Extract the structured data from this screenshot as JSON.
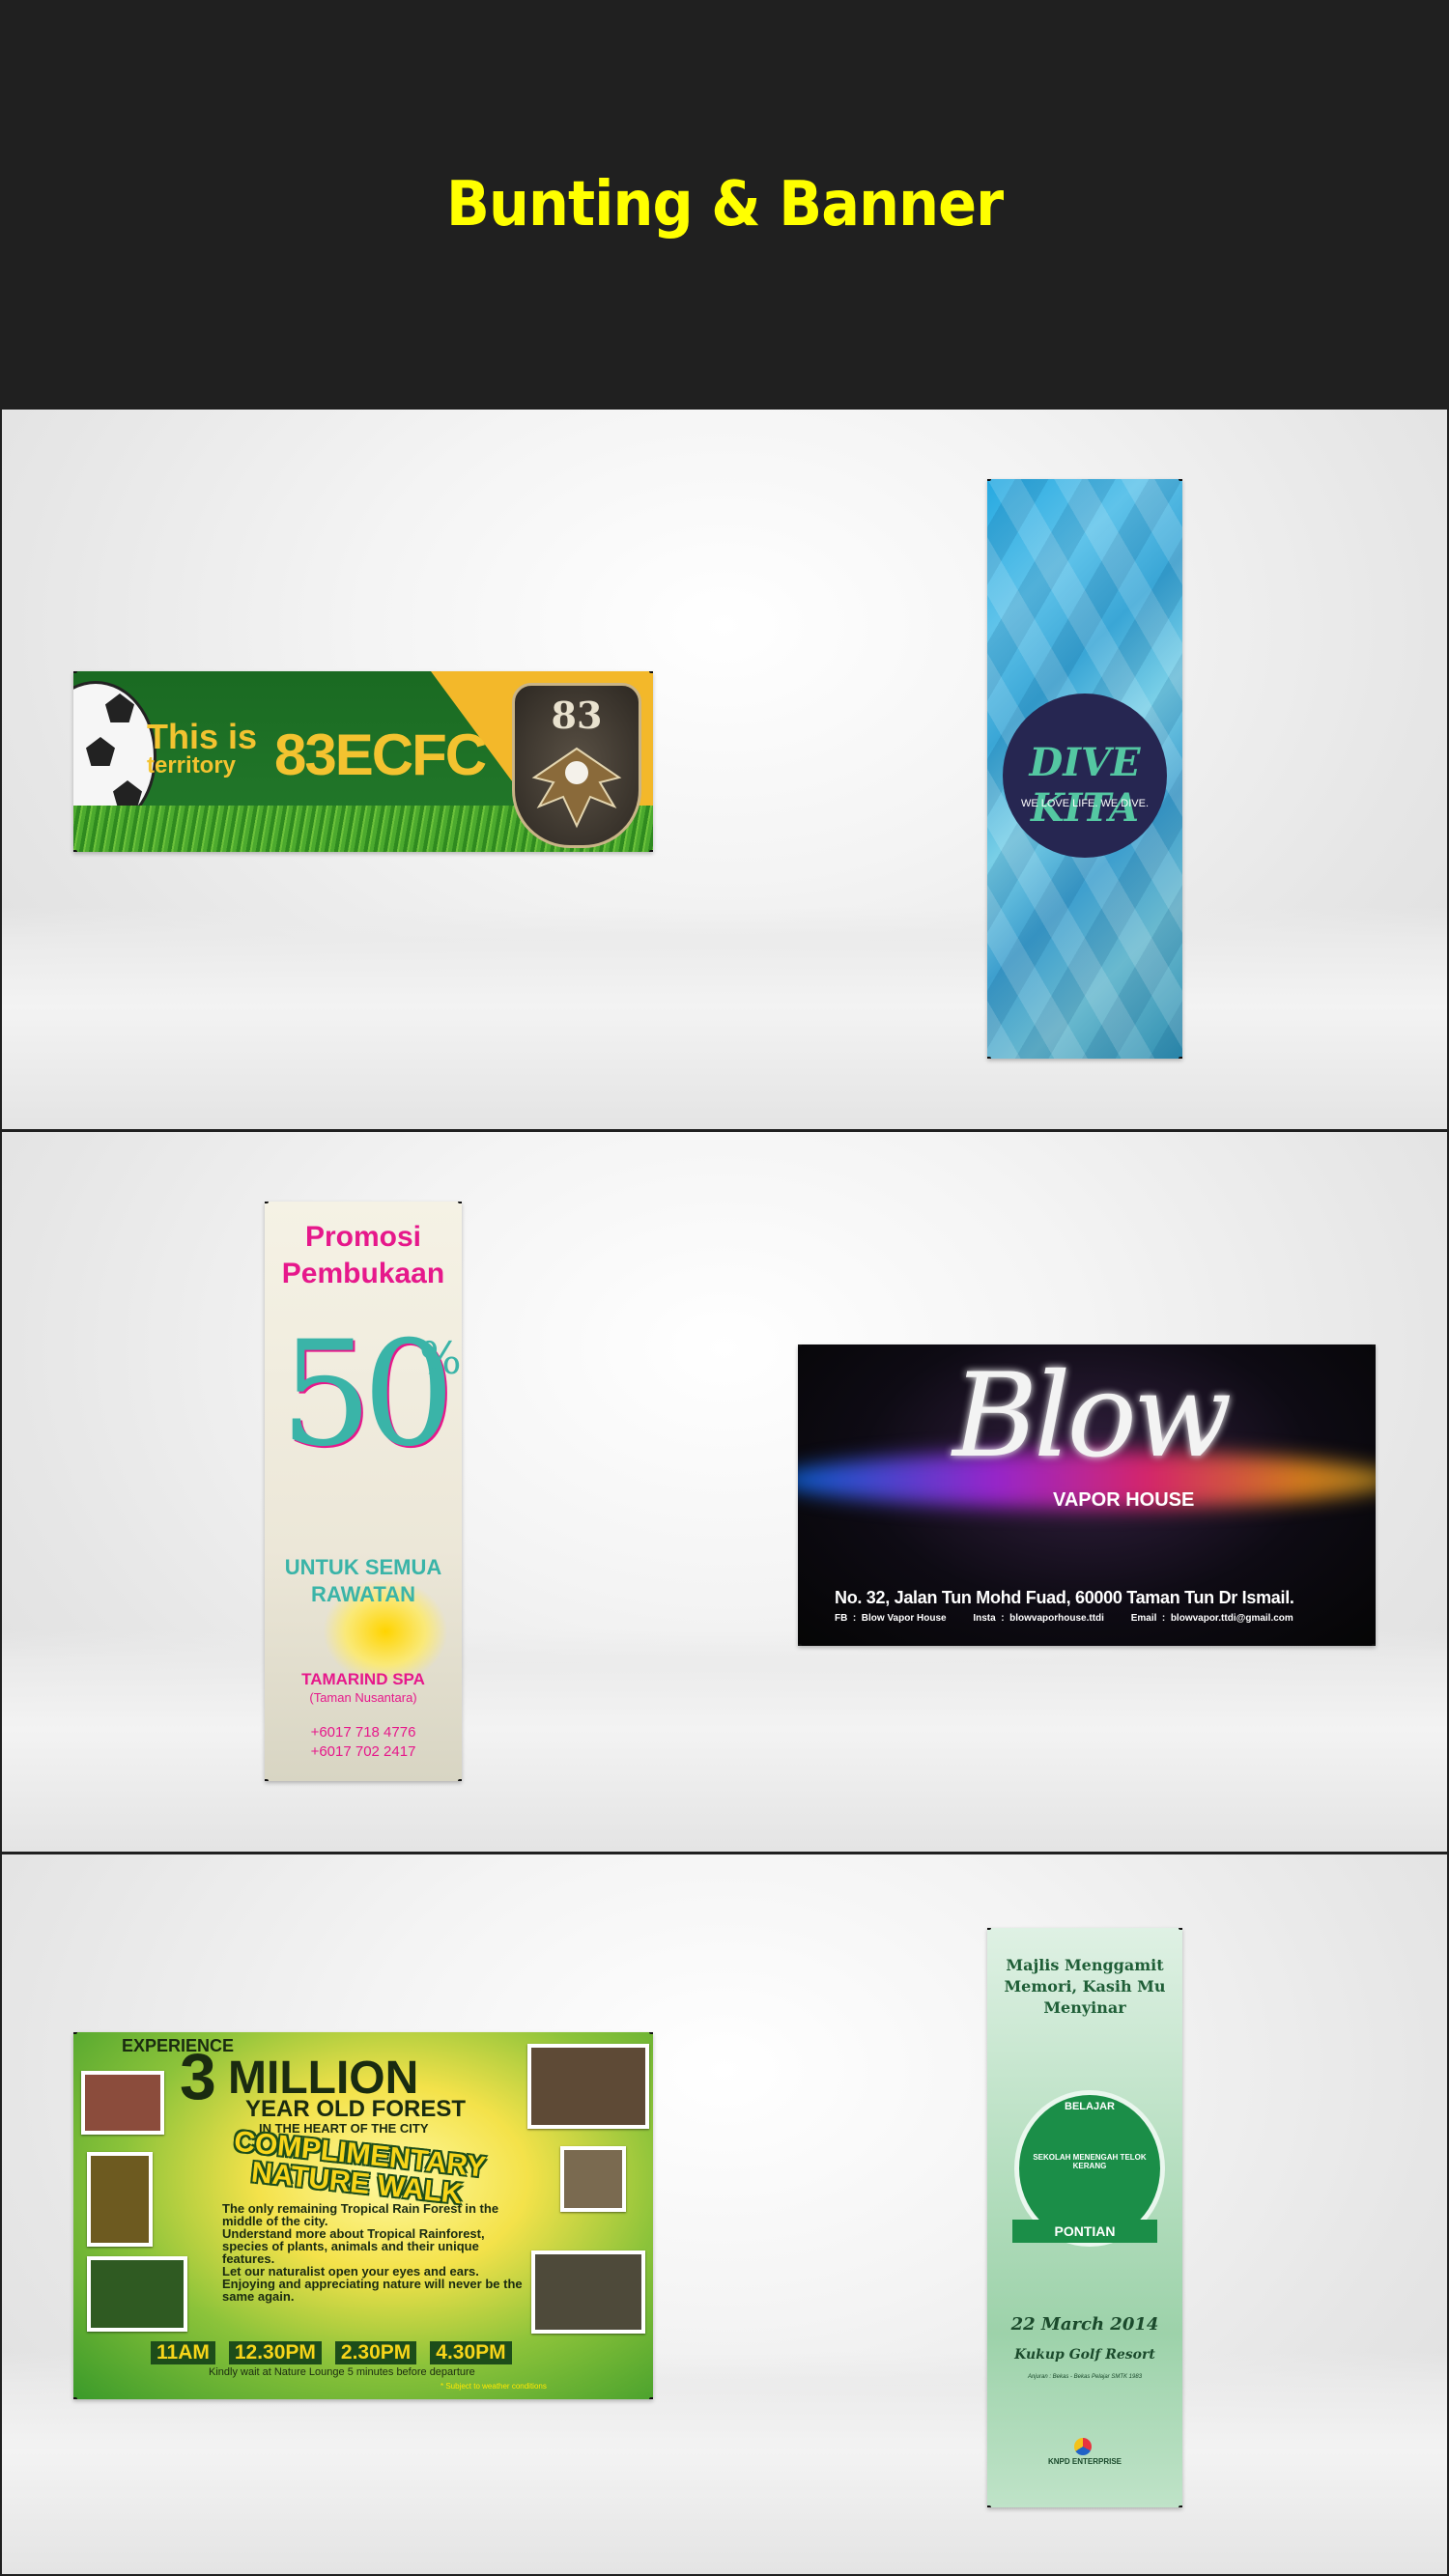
{
  "header": {
    "title": "Bunting & Banner"
  },
  "banners": {
    "fc": {
      "line1": "This is",
      "line2": "territory",
      "club": "83ECFC",
      "crest_text": "83"
    },
    "dive": {
      "logo": "DIVE KITA",
      "tagline": "WE LOVE LIFE. WE DIVE."
    },
    "spa": {
      "promo": "Promosi Pembukaan",
      "discount": "50",
      "percent": "%",
      "untuk": "UNTUK SEMUA RAWATAN",
      "name": "TAMARIND SPA",
      "location": "(Taman Nusantara)",
      "phones": "+6017 718 4776\n+6017 702 2417"
    },
    "vapor": {
      "logo": "Blow",
      "sub": "VAPOR HOUSE",
      "address": "No. 32, Jalan Tun Mohd Fuad, 60000 Taman Tun Dr Ismail.",
      "contacts": "FB  :  Blow Vapor House          Insta  :  blowvaporhouse.ttdi          Email  :  blowvapor.ttdi@gmail.com"
    },
    "forest": {
      "experience": "EXPERIENCE",
      "three": "3",
      "million": "MILLION",
      "year_old": "YEAR OLD FOREST",
      "heart": "IN THE HEART OF THE CITY",
      "complimentary": "COMPLIMENTARY NATURE WALK",
      "body": "The only remaining Tropical Rain Forest in the middle of the city.\nUnderstand more about Tropical Rainforest, species of plants, animals and their unique features.\nLet our naturalist open your eyes and ears. Enjoying and appreciating nature will never be the same again.",
      "times": [
        "11AM",
        "12.30PM",
        "2.30PM",
        "4.30PM"
      ],
      "kindly": "Kindly wait at Nature Lounge 5 minutes before departure",
      "subject": "* Subject to weather conditions"
    },
    "school": {
      "title": "Majlis Menggamit Memori, Kasih Mu Menyinar",
      "belajar": "BELAJAR",
      "crest_ring": "SEKOLAH MENENGAH TELOK KERANG",
      "pontian": "PONTIAN",
      "date": "22 March 2014",
      "venue": "Kukup Golf Resort",
      "organizer": "Anjuran : Bekas - Bekas Pelajar SMTK 1983",
      "enterprise": "KNPD ENTERPRISE"
    }
  }
}
